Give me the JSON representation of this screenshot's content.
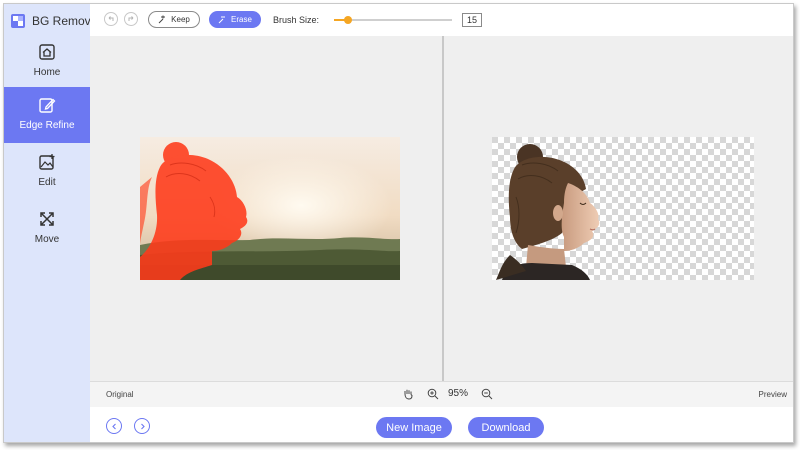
{
  "app": {
    "title": "BG Remover",
    "logo_icon": "bg-remover-logo-icon"
  },
  "sidebar": {
    "items": [
      {
        "label": "Home",
        "icon": "home-icon",
        "active": false
      },
      {
        "label": "Edge Refine",
        "icon": "edit-pen-icon",
        "active": true
      },
      {
        "label": "Edit",
        "icon": "image-edit-icon",
        "active": false
      },
      {
        "label": "Move",
        "icon": "move-arrows-icon",
        "active": false
      }
    ]
  },
  "toolbar": {
    "undo_icon": "undo-icon",
    "redo_icon": "redo-icon",
    "keep_label": "Keep",
    "erase_label": "Erase",
    "brush_label": "Brush Size:",
    "brush_size": "15",
    "brush_slider_fraction": 0.12
  },
  "status": {
    "original_label": "Original",
    "preview_label": "Preview",
    "zoom": "95%"
  },
  "bottom": {
    "new_image_label": "New Image",
    "download_label": "Download"
  },
  "colors": {
    "accent": "#6c78f2",
    "sidebar_bg": "#dde5fb",
    "slider_accent": "#f5a623",
    "mask_overlay": "#ff3a1a"
  }
}
